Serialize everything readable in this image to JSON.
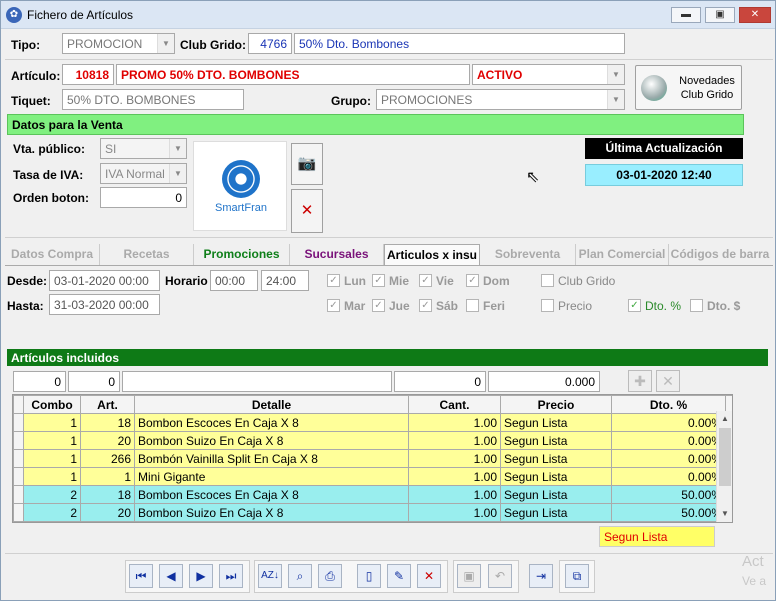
{
  "window": {
    "title": "Fichero de Artículos",
    "minimize": "▬",
    "maximize": "▣",
    "close": "✕"
  },
  "tipo": {
    "label": "Tipo:",
    "value": "PROMOCION"
  },
  "club": {
    "label": "Club Grido:",
    "code": "4766",
    "name": "50% Dto. Bombones"
  },
  "articulo": {
    "label": "Artículo:",
    "code": "10818",
    "name": "PROMO 50% DTO. BOMBONES",
    "estado": "ACTIVO"
  },
  "tiquet": {
    "label": "Tiquet:",
    "value": "50% DTO. BOMBONES"
  },
  "grupo": {
    "label": "Grupo:",
    "value": "PROMOCIONES"
  },
  "novedades": {
    "line1": "Novedades",
    "line2": "Club Grido"
  },
  "venta": {
    "header": "Datos para la Venta",
    "vta_label": "Vta. público:",
    "vta_value": "SI",
    "iva_label": "Tasa de IVA:",
    "iva_value": "IVA Normal",
    "orden_label": "Orden boton:",
    "orden_value": "0",
    "logo_text": "SmartFran"
  },
  "actualizacion": {
    "label": "Última Actualización",
    "value": "03-01-2020 12:40"
  },
  "tabs": [
    {
      "label": "Datos Compra",
      "color": "#aaaaaa"
    },
    {
      "label": "Recetas",
      "color": "#aaaaaa"
    },
    {
      "label": "Promociones",
      "color": "#0f7f1a"
    },
    {
      "label": "Sucursales",
      "color": "#7a127a"
    },
    {
      "label": "Articulos x insu",
      "color": "#000000"
    },
    {
      "label": "Sobreventa",
      "color": "#aaaaaa"
    },
    {
      "label": "Plan Comercial",
      "color": "#aaaaaa"
    },
    {
      "label": "Códigos de barra",
      "color": "#aaaaaa"
    }
  ],
  "promo": {
    "desde_label": "Desde:",
    "desde_value": "03-01-2020 00:00",
    "hasta_label": "Hasta:",
    "hasta_value": "31-03-2020 00:00",
    "horario_label": "Horario",
    "hora_desde": "00:00",
    "hora_hasta": "24:00",
    "days": {
      "lun": "Lun",
      "mie": "Mie",
      "vie": "Vie",
      "dom": "Dom",
      "mar": "Mar",
      "jue": "Jue",
      "sab": "Sáb",
      "feri": "Feri"
    },
    "opts": {
      "club": "Club Grido",
      "precio": "Precio",
      "dtop": "Dto. %",
      "dtod": "Dto. $"
    }
  },
  "incluidos": {
    "header": "Artículos incluidos",
    "in_combo": "0",
    "in_art": "0",
    "in_cant": "0",
    "in_precio": "0.000"
  },
  "grid": {
    "columns": [
      "Combo",
      "Art.",
      "Detalle",
      "Cant.",
      "Precio",
      "Dto. %"
    ],
    "rows": [
      {
        "combo": "1",
        "art": "18",
        "detalle": "Bombon Escoces En Caja X 8",
        "cant": "1.00",
        "precio": "Segun Lista",
        "dto": "0.00%",
        "style": "yel"
      },
      {
        "combo": "1",
        "art": "20",
        "detalle": "Bombon Suizo En Caja X 8",
        "cant": "1.00",
        "precio": "Segun Lista",
        "dto": "0.00%",
        "style": "yel"
      },
      {
        "combo": "1",
        "art": "266",
        "detalle": "Bombón Vainilla Split En Caja X 8",
        "cant": "1.00",
        "precio": "Segun Lista",
        "dto": "0.00%",
        "style": "yel"
      },
      {
        "combo": "1",
        "art": "1",
        "detalle": "Mini Gigante",
        "cant": "1.00",
        "precio": "Segun Lista",
        "dto": "0.00%",
        "style": "yel"
      },
      {
        "combo": "2",
        "art": "18",
        "detalle": "Bombon Escoces En Caja X 8",
        "cant": "1.00",
        "precio": "Segun Lista",
        "dto": "50.00%",
        "style": "cyan"
      },
      {
        "combo": "2",
        "art": "20",
        "detalle": "Bombon Suizo En Caja X 8",
        "cant": "1.00",
        "precio": "Segun Lista",
        "dto": "50.00%",
        "style": "cyan"
      }
    ]
  },
  "segun_lista": "Segun Lista",
  "activate": {
    "line1": "Act",
    "line2": "Ve a"
  }
}
